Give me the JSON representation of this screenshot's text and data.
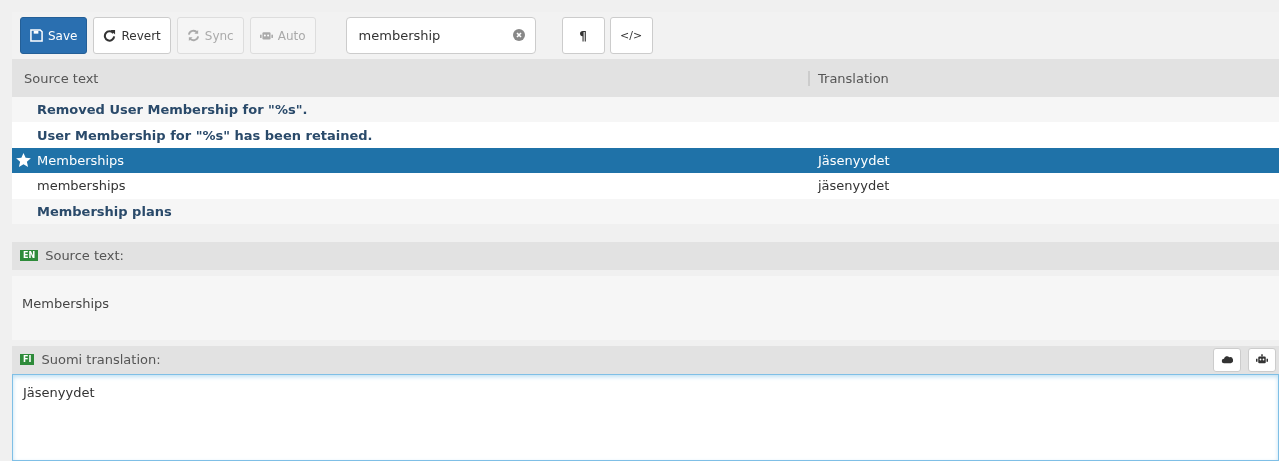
{
  "toolbar": {
    "buttons": [
      {
        "kind": "save",
        "label": "Save",
        "disabled": false
      },
      {
        "kind": "revert",
        "label": "Revert",
        "disabled": false
      },
      {
        "kind": "sync",
        "label": "Sync",
        "disabled": true
      },
      {
        "kind": "auto",
        "label": "Auto",
        "disabled": true
      }
    ],
    "search": {
      "value": "membership"
    },
    "toggles": [
      {
        "kind": "pilcrow",
        "label": "¶"
      },
      {
        "kind": "code",
        "label": "</>"
      }
    ]
  },
  "table": {
    "columns": [
      "Source text",
      "Translation"
    ],
    "rows": [
      {
        "source": "Removed User Membership for \"%s\".",
        "translation": "",
        "untranslated": true,
        "selected": false,
        "starred": false
      },
      {
        "source": "User Membership for \"%s\" has been retained.",
        "translation": "",
        "untranslated": true,
        "selected": false,
        "starred": false
      },
      {
        "source": "Memberships",
        "translation": "Jäsenyydet",
        "untranslated": false,
        "selected": true,
        "starred": true
      },
      {
        "source": "memberships",
        "translation": "jäsenyydet",
        "untranslated": false,
        "selected": false,
        "starred": false
      },
      {
        "source": "Membership plans",
        "translation": "",
        "untranslated": true,
        "selected": false,
        "starred": false
      }
    ]
  },
  "source_panel": {
    "lang": "EN",
    "label": "Source text:",
    "text": "Memberships"
  },
  "translation_panel": {
    "lang": "FI",
    "label": "Suomi translation:",
    "value": "Jäsenyydet"
  }
}
